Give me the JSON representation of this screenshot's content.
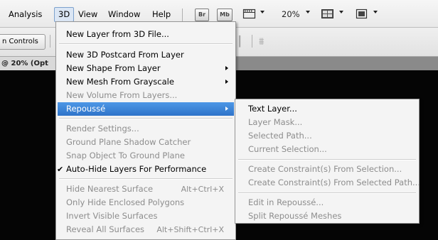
{
  "menubar": {
    "items": [
      {
        "label": "Analysis"
      },
      {
        "label": "3D"
      },
      {
        "label": "View"
      },
      {
        "label": "Window"
      },
      {
        "label": "Help"
      }
    ],
    "bridge_label": "Br",
    "minibridge_label": "Mb",
    "zoom": "20%"
  },
  "options": {
    "controls_label": "n Controls"
  },
  "document": {
    "tab_label": "@ 20% (Opt"
  },
  "menu3d": {
    "items": [
      {
        "label": "New Layer from 3D File...",
        "shortcut": ""
      },
      {
        "label": "New 3D Postcard From Layer",
        "shortcut": ""
      },
      {
        "label": "New Shape From Layer",
        "shortcut": ""
      },
      {
        "label": "New Mesh From Grayscale",
        "shortcut": ""
      },
      {
        "label": "New Volume From Layers...",
        "shortcut": ""
      },
      {
        "label": "Repoussé",
        "shortcut": ""
      },
      {
        "label": "Render Settings...",
        "shortcut": ""
      },
      {
        "label": "Ground Plane Shadow Catcher",
        "shortcut": ""
      },
      {
        "label": "Snap Object To Ground Plane",
        "shortcut": ""
      },
      {
        "label": "Auto-Hide Layers For Performance",
        "shortcut": ""
      },
      {
        "label": "Hide Nearest Surface",
        "shortcut": "Alt+Ctrl+X"
      },
      {
        "label": "Only Hide Enclosed Polygons",
        "shortcut": ""
      },
      {
        "label": "Invert Visible Surfaces",
        "shortcut": ""
      },
      {
        "label": "Reveal All Surfaces",
        "shortcut": "Alt+Shift+Ctrl+X"
      }
    ]
  },
  "submenu": {
    "items": [
      {
        "label": "Text Layer..."
      },
      {
        "label": "Layer Mask..."
      },
      {
        "label": "Selected Path..."
      },
      {
        "label": "Current Selection..."
      },
      {
        "label": "Create Constraint(s) From Selection..."
      },
      {
        "label": "Create Constraint(s) From Selected Path..."
      },
      {
        "label": "Edit in Repoussé..."
      },
      {
        "label": "Split Repoussé Meshes"
      }
    ]
  }
}
